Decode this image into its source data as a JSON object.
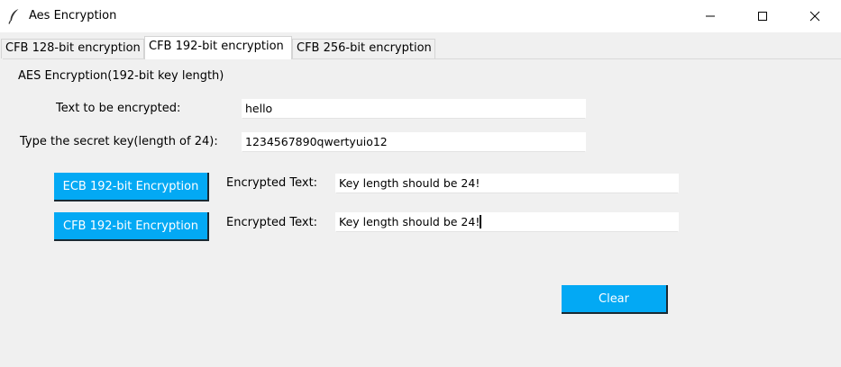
{
  "window": {
    "title": "Aes Encryption",
    "icon": "feather-icon",
    "controls": [
      "minimize-icon",
      "maximize-icon",
      "close-icon"
    ]
  },
  "tabs": [
    {
      "label": "CFB 128-bit encryption",
      "active": false
    },
    {
      "label": "CFB 192-bit encryption",
      "active": true
    },
    {
      "label": "CFB 256-bit encryption",
      "active": false
    }
  ],
  "panel": {
    "heading": "AES Encryption(192-bit key length)",
    "plaintext_label": "Text to be encrypted:",
    "plaintext_value": "hello",
    "key_label": "Type the secret key(length of 24):",
    "key_value": "1234567890qwertyuio12",
    "ecb_button": "ECB 192-bit Encryption",
    "cfb_button": "CFB 192-bit Encryption",
    "ecb_output_label": "Encrypted Text:",
    "ecb_output_value": "Key length should be 24!",
    "cfb_output_label": "Encrypted Text:",
    "cfb_output_value": "Key length should be 24!",
    "clear_button": "Clear"
  },
  "colors": {
    "button_bg": "#03a9f4",
    "button_text": "#ffffff",
    "window_bg": "#f0f0f0"
  }
}
